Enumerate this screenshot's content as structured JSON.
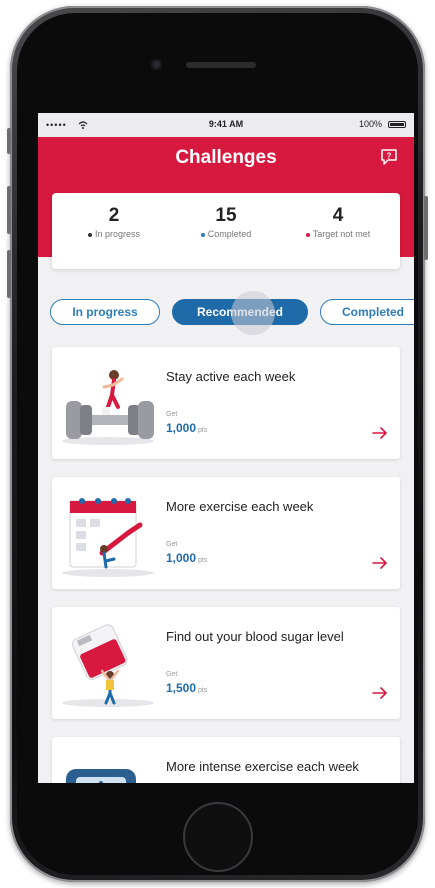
{
  "status_bar": {
    "signal": "•••••",
    "wifi_icon": "wifi-icon",
    "time": "9:41 AM",
    "battery": "100%"
  },
  "header": {
    "title": "Challenges",
    "help_icon": "help-chat-icon"
  },
  "colors": {
    "brand_red": "#d7193f",
    "accent_blue": "#1f6aa8",
    "dot_dark": "#333333",
    "dot_blue": "#2f7db8",
    "dot_red": "#d7193f"
  },
  "summary": {
    "stats": [
      {
        "value": "2",
        "label": "In progress"
      },
      {
        "value": "15",
        "label": "Completed"
      },
      {
        "value": "4",
        "label": "Target not met"
      }
    ]
  },
  "tabs": [
    {
      "label": "In progress",
      "active": false
    },
    {
      "label": "Recommended",
      "active": true
    },
    {
      "label": "Completed",
      "active": false
    }
  ],
  "challenges": [
    {
      "title": "Stay active each week",
      "get_label": "Get",
      "points": "1,000",
      "unit": "pts",
      "illustration": "dumbbell-runner-illustration"
    },
    {
      "title": "More exercise each week",
      "get_label": "Get",
      "points": "1,000",
      "unit": "pts",
      "illustration": "calendar-exercise-illustration"
    },
    {
      "title": "Find out your blood sugar level",
      "get_label": "Get",
      "points": "1,500",
      "unit": "pts",
      "illustration": "blood-drop-illustration"
    },
    {
      "title": "More intense exercise each week",
      "illustration": "scale-illustration"
    }
  ],
  "arrow_icon": "arrow-right-icon"
}
